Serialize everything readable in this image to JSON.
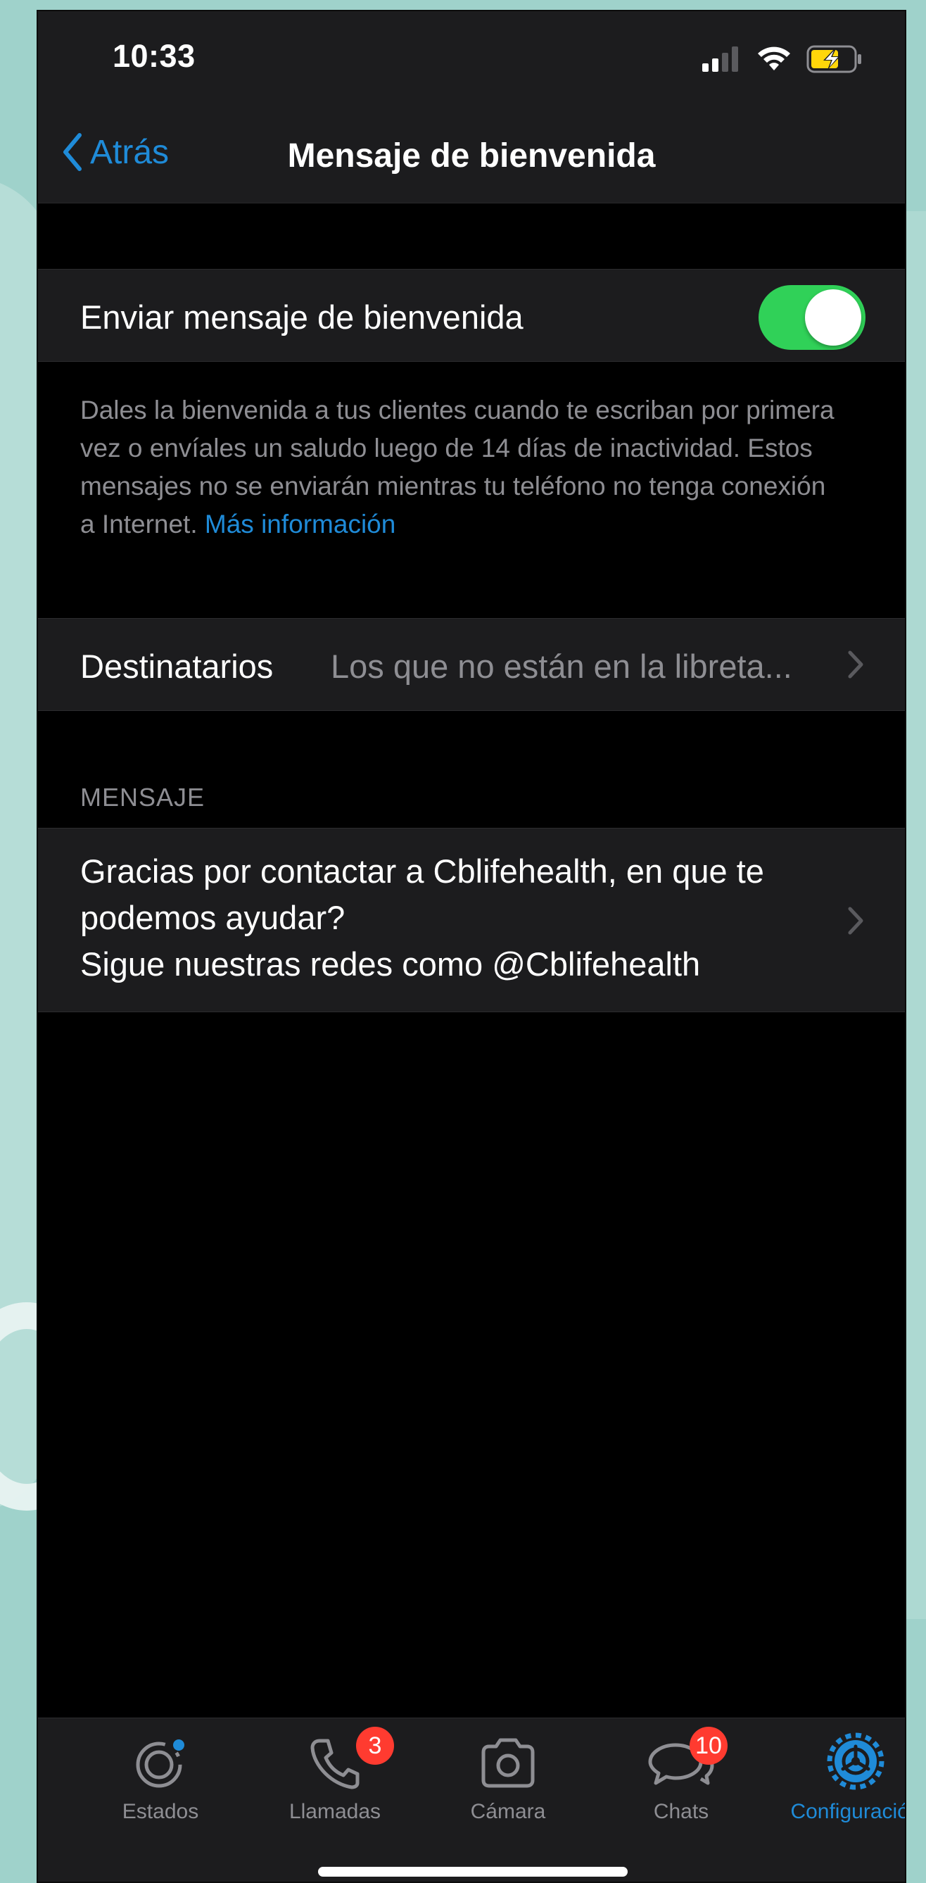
{
  "status_bar": {
    "time": "10:33"
  },
  "nav": {
    "back_label": "Atrás",
    "title": "Mensaje de bienvenida"
  },
  "welcome_toggle": {
    "label": "Enviar mensaje de bienvenida",
    "enabled": true
  },
  "description": {
    "text": "Dales la bienvenida a tus clientes cuando te escriban por primera vez o envíales un saludo luego de 14 días de inactividad. Estos mensajes no se enviarán mientras tu teléfono no tenga conexión a Internet. ",
    "link": "Más información"
  },
  "recipients": {
    "label": "Destinatarios",
    "value": "Los que no están en la libreta..."
  },
  "message_section": {
    "header": "MENSAJE",
    "line1": "Gracias por contactar a Cblifehealth, en que te podemos ayudar?",
    "line2": "Sigue nuestras redes como @Cblifehealth"
  },
  "tabs": [
    {
      "label": "Estados",
      "icon": "status-icon"
    },
    {
      "label": "Llamadas",
      "icon": "phone-icon",
      "badge": "3"
    },
    {
      "label": "Cámara",
      "icon": "camera-icon"
    },
    {
      "label": "Chats",
      "icon": "chats-icon",
      "badge": "10"
    },
    {
      "label": "Configuración",
      "icon": "gear-icon",
      "active": true
    }
  ],
  "colors": {
    "accent": "#1f8bd8",
    "toggle_on": "#30d158",
    "badge": "#ff3b30",
    "background": "#000000",
    "cell": "#1c1c1e"
  }
}
